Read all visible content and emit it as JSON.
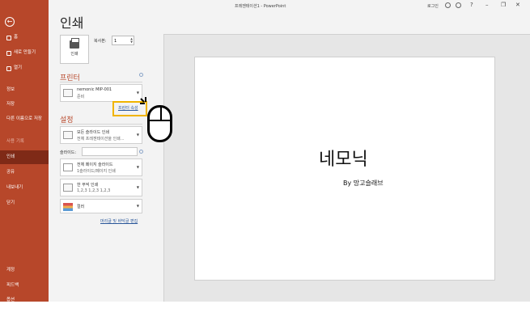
{
  "titlebar": {
    "title": "프레젠테이션1 - PowerPoint",
    "sign_in": "로그인",
    "help": "?",
    "minimize": "–",
    "restore": "❐",
    "close": "✕"
  },
  "sidebar": {
    "back_glyph": "←",
    "items": [
      {
        "label": "홈"
      },
      {
        "label": "새로 만들기"
      },
      {
        "label": "열기"
      },
      {
        "label": "정보"
      },
      {
        "label": "저장"
      },
      {
        "label": "다른 이름으로 저장"
      },
      {
        "label": "사용 기록"
      },
      {
        "label": "인쇄"
      },
      {
        "label": "공유"
      },
      {
        "label": "내보내기"
      },
      {
        "label": "닫기"
      },
      {
        "label": "계정"
      },
      {
        "label": "피드백"
      },
      {
        "label": "옵션"
      }
    ]
  },
  "main": {
    "title": "인쇄",
    "print_button": "인쇄",
    "copies_label": "복사본:",
    "copies_value": "1",
    "printer_section": "프린터",
    "printer_name": "nemonic MIP-001",
    "printer_status": "준비",
    "printer_properties_link": "프린터 속성",
    "settings_section": "설정",
    "setting_range_main": "모든 슬라이드 인쇄",
    "setting_range_sub": "전체 프레젠테이션을 인쇄...",
    "slides_label": "슬라이드:",
    "slides_value": "",
    "setting_layout_main": "전체 페이지 슬라이드",
    "setting_layout_sub": "1슬라이드/페이지 인쇄",
    "setting_collate_main": "한 부씩 인쇄",
    "setting_collate_sub": "1,2,3    1,2,3    1,2,3",
    "setting_color_main": "컬러",
    "footer_link": "머리글 및 바닥글 편집"
  },
  "preview": {
    "slide_title": "네모닉",
    "slide_subtitle": "By 망고슬래브"
  }
}
